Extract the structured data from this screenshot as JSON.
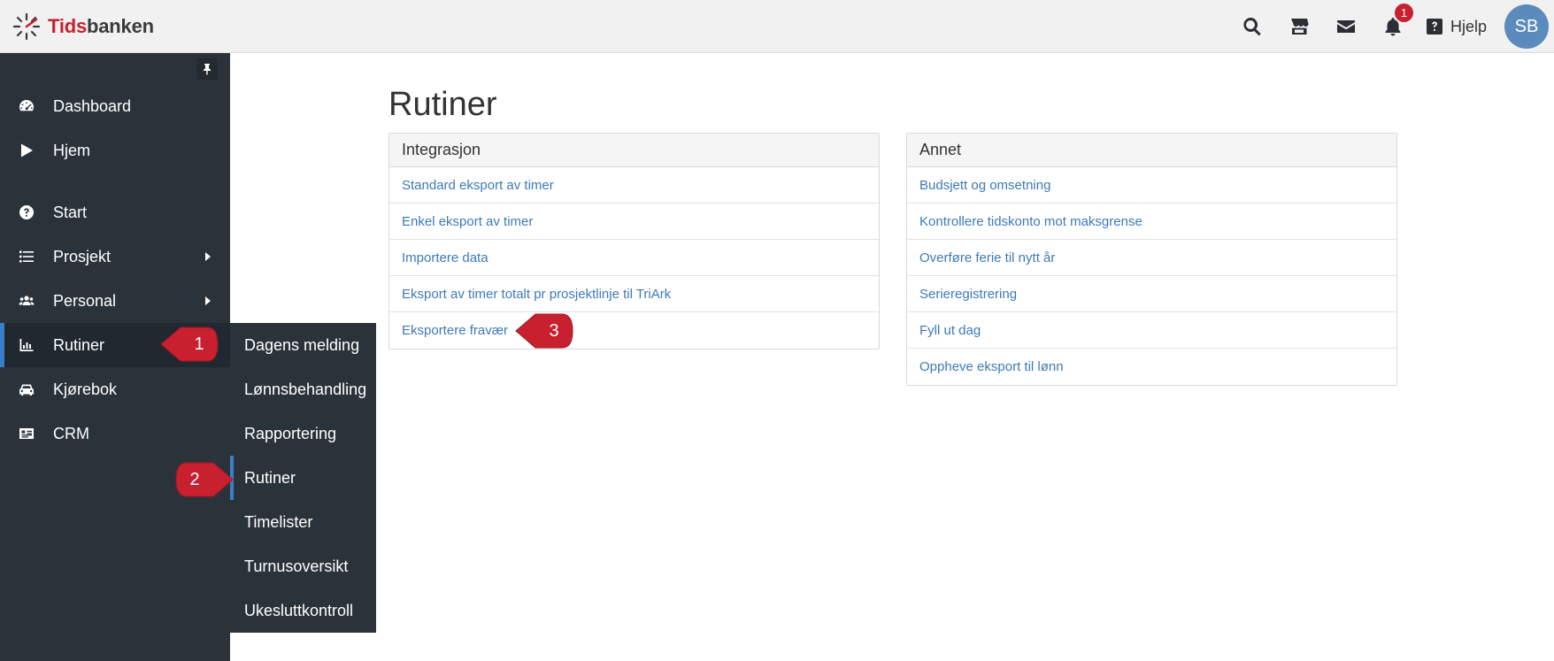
{
  "app": {
    "logo_part1": "Tids",
    "logo_part2": "banken"
  },
  "topbar": {
    "notification_count": "1",
    "help_label": "Hjelp",
    "avatar_initials": "SB"
  },
  "sidebar": {
    "items": [
      {
        "label": "Dashboard",
        "icon": "dashboard-icon"
      },
      {
        "label": "Hjem",
        "icon": "play-icon"
      },
      {
        "label": "Start",
        "icon": "question-circle-icon"
      },
      {
        "label": "Prosjekt",
        "icon": "list-icon",
        "has_submenu": true
      },
      {
        "label": "Personal",
        "icon": "users-icon",
        "has_submenu": true
      },
      {
        "label": "Rutiner",
        "icon": "bar-chart-icon",
        "active": true
      },
      {
        "label": "Kjørebok",
        "icon": "car-icon"
      },
      {
        "label": "CRM",
        "icon": "id-card-icon"
      }
    ]
  },
  "submenu": {
    "items": [
      {
        "label": "Dagens melding"
      },
      {
        "label": "Lønnsbehandling"
      },
      {
        "label": "Rapportering"
      },
      {
        "label": "Rutiner",
        "active": true
      },
      {
        "label": "Timelister"
      },
      {
        "label": "Turnusoversikt"
      },
      {
        "label": "Ukesluttkontroll"
      }
    ]
  },
  "main": {
    "title": "Rutiner",
    "panels": [
      {
        "heading": "Integrasjon",
        "links": [
          "Standard eksport av timer",
          "Enkel eksport av timer",
          "Importere data",
          "Eksport av timer totalt pr prosjektlinje til TriArk",
          "Eksportere fravær"
        ]
      },
      {
        "heading": "Annet",
        "links": [
          "Budsjett og omsetning",
          "Kontrollere tidskonto mot maksgrense",
          "Overføre ferie til nytt år",
          "Serieregistrering",
          "Fyll ut dag",
          "Oppheve eksport til lønn"
        ]
      }
    ]
  },
  "callouts": {
    "one": "1",
    "two": "2",
    "three": "3",
    "color": "#c8202f"
  },
  "colors": {
    "sidebar_bg": "#2b333a",
    "accent": "#3a7ec9",
    "link": "#3d7ab8",
    "brand_red": "#c8202f"
  }
}
